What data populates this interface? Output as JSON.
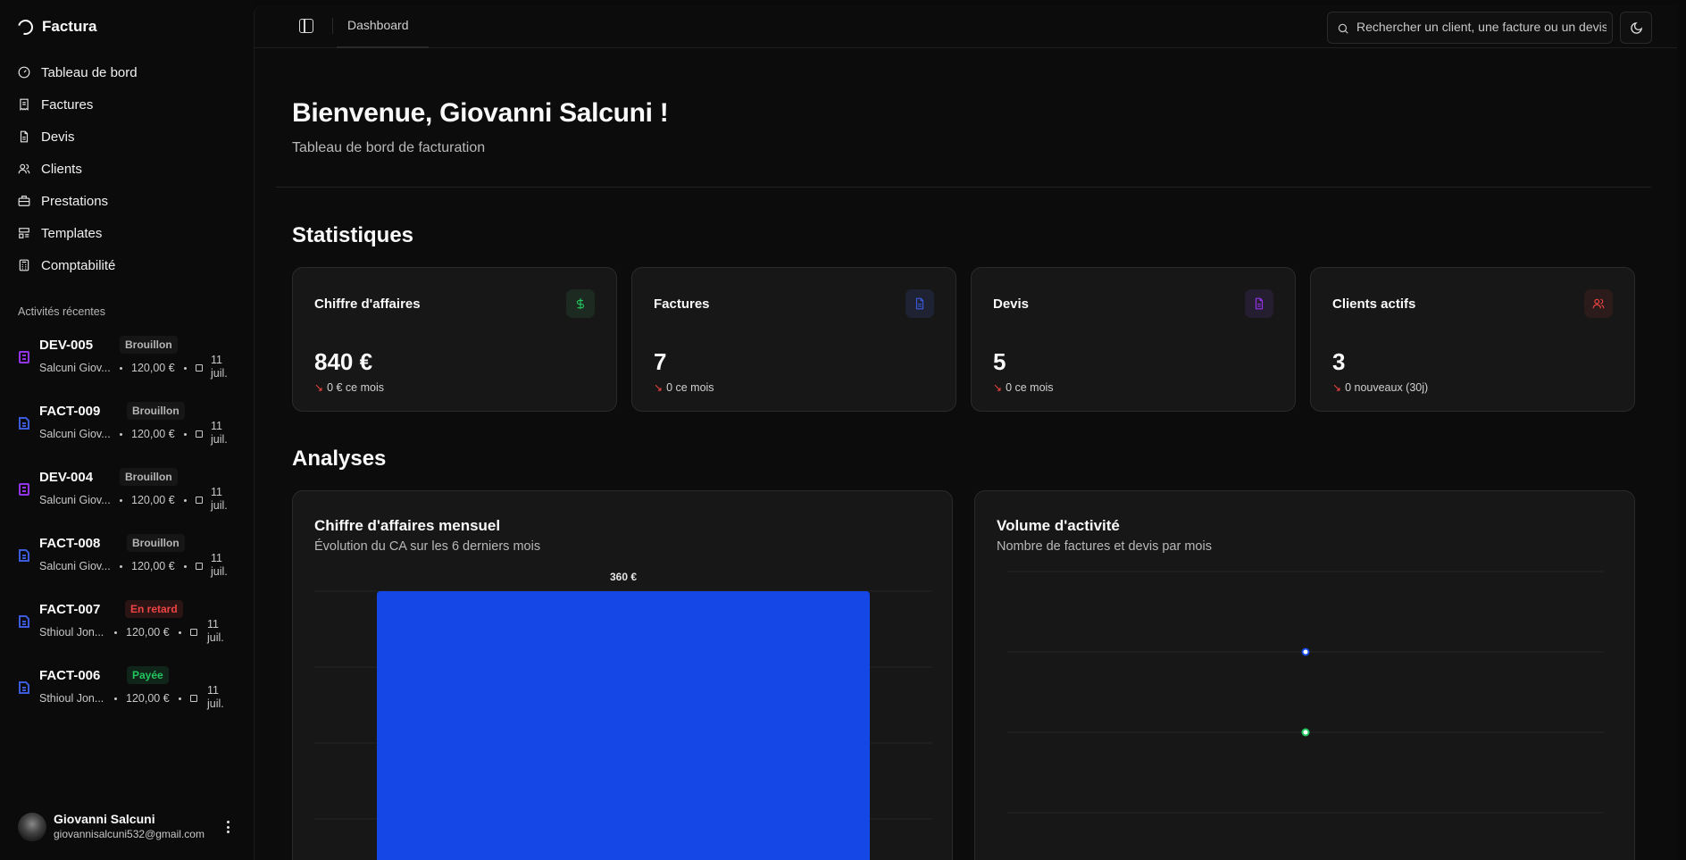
{
  "app": {
    "name": "Factura"
  },
  "sidebar": {
    "nav": [
      {
        "label": "Tableau de bord",
        "icon": "gauge-icon"
      },
      {
        "label": "Factures",
        "icon": "receipt-icon"
      },
      {
        "label": "Devis",
        "icon": "file-icon"
      },
      {
        "label": "Clients",
        "icon": "users-icon"
      },
      {
        "label": "Prestations",
        "icon": "briefcase-icon"
      },
      {
        "label": "Templates",
        "icon": "layout-icon"
      },
      {
        "label": "Comptabilité",
        "icon": "calculator-icon"
      }
    ],
    "activities_label": "Activités récentes",
    "activities": [
      {
        "code": "DEV-005",
        "status": "Brouillon",
        "client": "Salcuni Giov...",
        "amount": "120,00 €",
        "date": "11 juil.",
        "type": "devis"
      },
      {
        "code": "FACT-009",
        "status": "Brouillon",
        "client": "Salcuni Giov...",
        "amount": "120,00 €",
        "date": "11 juil.",
        "type": "facture"
      },
      {
        "code": "DEV-004",
        "status": "Brouillon",
        "client": "Salcuni Giov...",
        "amount": "120,00 €",
        "date": "11 juil.",
        "type": "devis"
      },
      {
        "code": "FACT-008",
        "status": "Brouillon",
        "client": "Salcuni Giov...",
        "amount": "120,00 €",
        "date": "11 juil.",
        "type": "facture"
      },
      {
        "code": "FACT-007",
        "status": "En retard",
        "client": "Sthioul Jon...",
        "amount": "120,00 €",
        "date": "11 juil.",
        "type": "facture"
      },
      {
        "code": "FACT-006",
        "status": "Payée",
        "client": "Sthioul Jon...",
        "amount": "120,00 €",
        "date": "11 juil.",
        "type": "facture"
      }
    ],
    "user": {
      "name": "Giovanni Salcuni",
      "email": "giovannisalcuni532@gmail.com"
    }
  },
  "topbar": {
    "breadcrumb": "Dashboard",
    "search_placeholder": "Rechercher un client, une facture ou un devis..."
  },
  "header": {
    "title": "Bienvenue, Giovanni Salcuni !",
    "subtitle": "Tableau de bord de facturation"
  },
  "stats": {
    "heading": "Statistiques",
    "cards": [
      {
        "title": "Chiffre d'affaires",
        "value": "840 €",
        "delta": "0 € ce mois",
        "icon": "dollar-icon",
        "accent": "#22c55e",
        "accent_bg": "#1c2a22"
      },
      {
        "title": "Factures",
        "value": "7",
        "delta": "0 ce mois",
        "icon": "file-icon",
        "accent": "#3b5bdb",
        "accent_bg": "#1e2233"
      },
      {
        "title": "Devis",
        "value": "5",
        "delta": "0 ce mois",
        "icon": "file-icon",
        "accent": "#9333ea",
        "accent_bg": "#251d30"
      },
      {
        "title": "Clients actifs",
        "value": "3",
        "delta": "0 nouveaux (30j)",
        "icon": "users-icon",
        "accent": "#ef4444",
        "accent_bg": "#2b1b1b"
      }
    ]
  },
  "analyses": {
    "heading": "Analyses",
    "revenue": {
      "title": "Chiffre d'affaires mensuel",
      "subtitle": "Évolution du CA sur les 6 derniers mois"
    },
    "volume": {
      "title": "Volume d'activité",
      "subtitle": "Nombre de factures et devis par mois"
    }
  },
  "chart_data": [
    {
      "type": "bar",
      "title": "Chiffre d'affaires mensuel",
      "categories": [
        ""
      ],
      "values": [
        360
      ],
      "value_labels": [
        "360 €"
      ],
      "color": "#1447e6",
      "grid": true
    },
    {
      "type": "line",
      "title": "Volume d'activité",
      "series": [
        {
          "values": [
            3
          ],
          "color": "#1447e6"
        },
        {
          "values": [
            2
          ],
          "color": "#22c55e"
        }
      ],
      "ylim": [
        0,
        4
      ],
      "grid": true
    }
  ]
}
